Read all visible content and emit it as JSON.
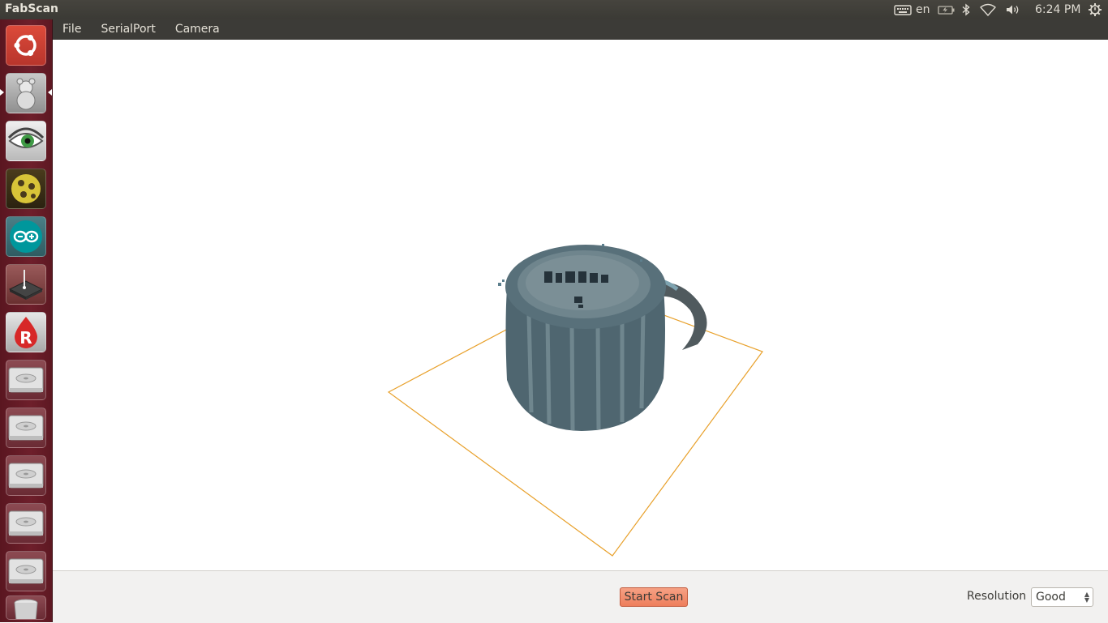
{
  "app": {
    "title": "FabScan"
  },
  "tray": {
    "keyboard_layout": "en",
    "time": "6:24 PM"
  },
  "menu": [
    {
      "label": "File"
    },
    {
      "label": "SerialPort"
    },
    {
      "label": "Camera"
    }
  ],
  "launcher": [
    {
      "icon": "ubuntu-dash-icon"
    },
    {
      "icon": "fabscan-app-icon",
      "active": true
    },
    {
      "icon": "eye-app-icon"
    },
    {
      "icon": "geometry-app-icon"
    },
    {
      "icon": "arduino-icon"
    },
    {
      "icon": "laser-device-icon"
    },
    {
      "icon": "r-app-icon"
    },
    {
      "icon": "drive-icon"
    },
    {
      "icon": "drive-icon"
    },
    {
      "icon": "drive-icon"
    },
    {
      "icon": "drive-icon"
    },
    {
      "icon": "drive-icon"
    },
    {
      "icon": "trash-icon"
    }
  ],
  "controls": {
    "start_scan_label": "Start Scan",
    "resolution_label": "Resolution",
    "resolution_value": "Good"
  },
  "colors": {
    "accent_button": "#ee7e5c",
    "launcher_bg": "#6e1f2b",
    "scan_platform": "#e8a02a",
    "point_cloud": "#4f6670"
  }
}
